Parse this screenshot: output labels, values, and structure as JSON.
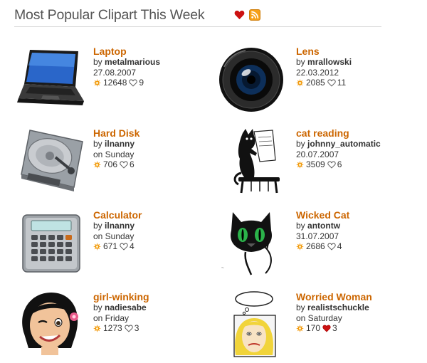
{
  "header": {
    "title": "Most Popular Clipart This Week"
  },
  "items": [
    {
      "title": "Laptop",
      "by": "by",
      "author": "metalmarious",
      "date": "27.08.2007",
      "downloads": "12648",
      "favorites": "9",
      "favorited": false,
      "icon": "laptop-icon"
    },
    {
      "title": "Lens",
      "by": "by",
      "author": "mrallowski",
      "date": "22.03.2012",
      "downloads": "2085",
      "favorites": "11",
      "favorited": false,
      "icon": "camera-lens-icon"
    },
    {
      "title": "Hard Disk",
      "by": "by",
      "author": "ilnanny",
      "date": "on Sunday",
      "downloads": "706",
      "favorites": "6",
      "favorited": false,
      "icon": "hard-disk-icon"
    },
    {
      "title": "cat reading",
      "by": "by",
      "author": "johnny_automatic",
      "date": "20.07.2007",
      "downloads": "3509",
      "favorites": "6",
      "favorited": false,
      "icon": "cat-reading-icon"
    },
    {
      "title": "Calculator",
      "by": "by",
      "author": "ilnanny",
      "date": "on Sunday",
      "downloads": "671",
      "favorites": "4",
      "favorited": false,
      "icon": "calculator-icon"
    },
    {
      "title": "Wicked Cat",
      "by": "by",
      "author": "antontw",
      "date": "31.07.2007",
      "downloads": "2686",
      "favorites": "4",
      "favorited": false,
      "icon": "wicked-cat-icon"
    },
    {
      "title": "girl-winking",
      "by": "by",
      "author": "nadiesabe",
      "date": "on Friday",
      "downloads": "1273",
      "favorites": "3",
      "favorited": false,
      "icon": "girl-winking-icon"
    },
    {
      "title": "Worried Woman",
      "by": "by",
      "author": "realistschuckle",
      "date": "on Saturday",
      "downloads": "170",
      "favorites": "3",
      "favorited": true,
      "icon": "worried-woman-icon"
    }
  ],
  "colors": {
    "title": "#cc6600",
    "heart": "#cc1111",
    "rss": "#f6a019",
    "download_star": "#f29a0e"
  }
}
